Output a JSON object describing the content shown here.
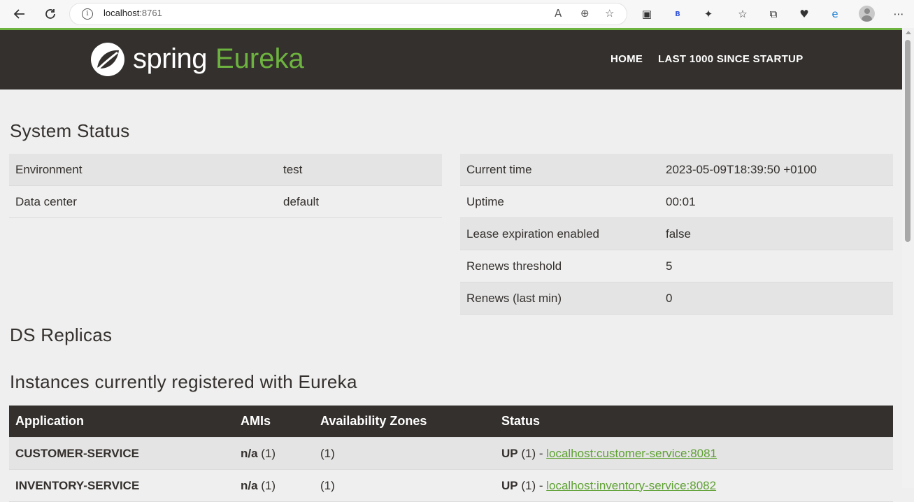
{
  "browser": {
    "url_host": "localhost",
    "url_port": ":8761",
    "back_icon": "back-arrow-icon",
    "refresh_icon": "refresh-icon"
  },
  "header": {
    "logo_word1": "spring",
    "logo_word2": "Eureka",
    "nav": [
      "HOME",
      "LAST 1000 SINCE STARTUP"
    ],
    "brand_color": "#6db33f",
    "bar_color": "#34302d"
  },
  "system_status": {
    "title": "System Status",
    "left": [
      {
        "label": "Environment",
        "value": "test"
      },
      {
        "label": "Data center",
        "value": "default"
      }
    ],
    "right": [
      {
        "label": "Current time",
        "value": "2023-05-09T18:39:50 +0100"
      },
      {
        "label": "Uptime",
        "value": "00:01"
      },
      {
        "label": "Lease expiration enabled",
        "value": "false"
      },
      {
        "label": "Renews threshold",
        "value": "5"
      },
      {
        "label": "Renews (last min)",
        "value": "0"
      }
    ]
  },
  "ds_replicas": {
    "title": "DS Replicas"
  },
  "instances": {
    "title": "Instances currently registered with Eureka",
    "columns": [
      "Application",
      "AMIs",
      "Availability Zones",
      "Status"
    ],
    "rows": [
      {
        "application": "CUSTOMER-SERVICE",
        "amis_bold": "n/a",
        "amis_count": " (1)",
        "zones": "(1)",
        "status_bold": "UP",
        "status_rest": " (1) - ",
        "link": "localhost:customer-service:8081"
      },
      {
        "application": "INVENTORY-SERVICE",
        "amis_bold": "n/a",
        "amis_count": " (1)",
        "zones": "(1)",
        "status_bold": "UP",
        "status_rest": " (1) - ",
        "link": "localhost:inventory-service:8082"
      }
    ]
  }
}
